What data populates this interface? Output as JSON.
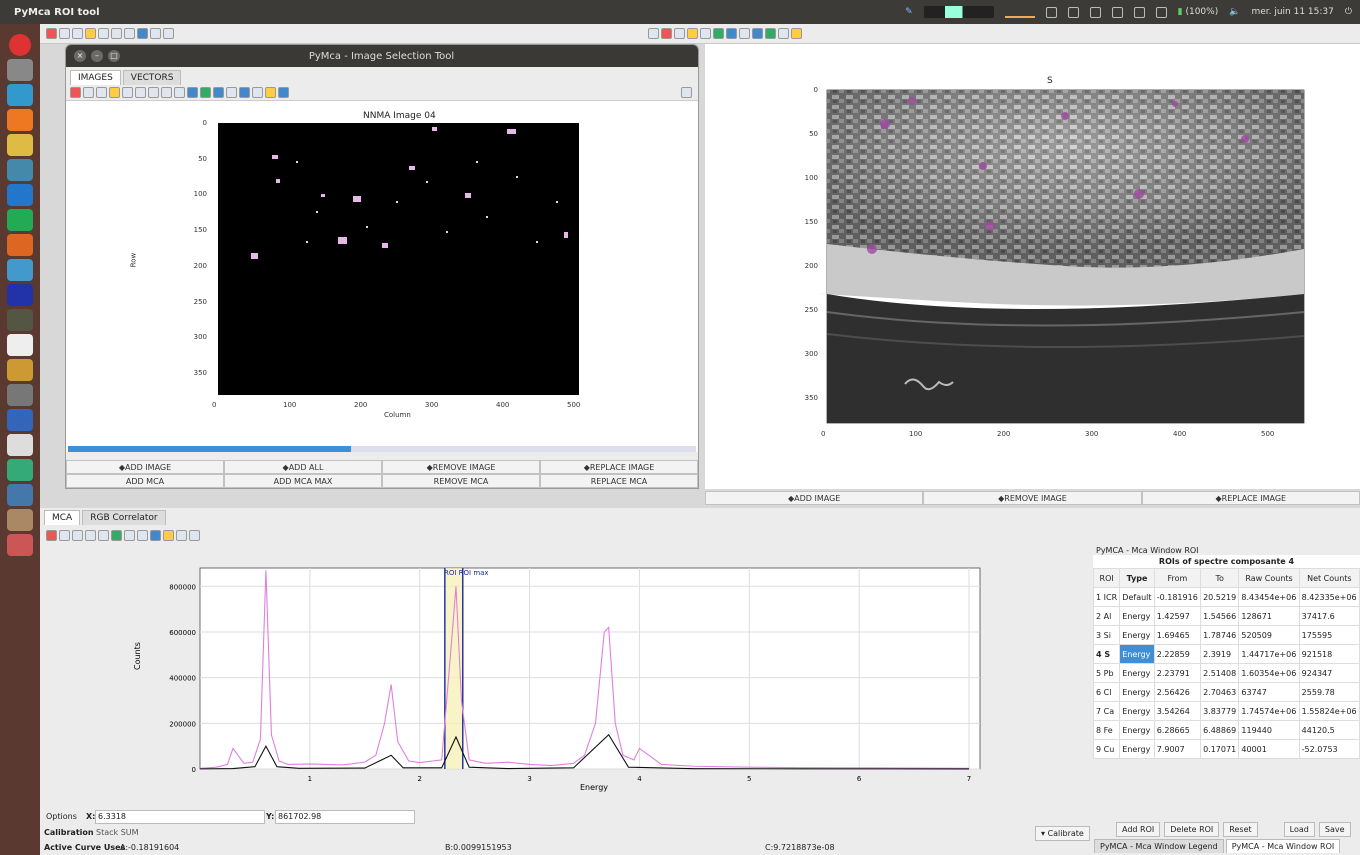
{
  "app": {
    "title": "PyMca ROI tool"
  },
  "systray": {
    "battery": "(100%)",
    "clock": "mer. juin 11  15:37"
  },
  "dialog": {
    "title": "PyMca - Image Selection Tool",
    "tabs": [
      "IMAGES",
      "VECTORS"
    ]
  },
  "left_image": {
    "title": "NNMA Image 04",
    "xlabel": "Column",
    "ylabel": "Row",
    "xticks": [
      "0",
      "100",
      "200",
      "300",
      "400",
      "500"
    ],
    "yticks": [
      "0",
      "50",
      "100",
      "150",
      "200",
      "250",
      "300",
      "350"
    ]
  },
  "right_image": {
    "title": "S",
    "xticks": [
      "0",
      "100",
      "200",
      "300",
      "400",
      "500"
    ],
    "yticks": [
      "0",
      "50",
      "100",
      "150",
      "200",
      "250",
      "300",
      "350"
    ]
  },
  "dialog_buttons_row1": [
    "ADD IMAGE",
    "ADD ALL",
    "REMOVE IMAGE",
    "REPLACE IMAGE"
  ],
  "dialog_buttons_row2": [
    "ADD MCA",
    "ADD MCA MAX",
    "REMOVE MCA",
    "REPLACE MCA"
  ],
  "right_buttons": [
    "ADD IMAGE",
    "REMOVE IMAGE",
    "REPLACE IMAGE"
  ],
  "bottom_tabs": [
    "MCA",
    "RGB Correlator"
  ],
  "mca_plot": {
    "ylabel": "Counts",
    "xlabel": "Energy",
    "yticks": [
      "0",
      "200000",
      "400000",
      "600000",
      "800000"
    ],
    "xticks": [
      "1",
      "2",
      "3",
      "4",
      "5",
      "6",
      "7"
    ],
    "markers": "ROI  ROI max"
  },
  "chart_data": {
    "type": "line",
    "title": "",
    "xlabel": "Energy",
    "ylabel": "Counts",
    "xlim": [
      0,
      7.1
    ],
    "ylim": [
      0,
      880000
    ],
    "series": [
      {
        "x": [
          0,
          0.15,
          0.25,
          0.3,
          0.4,
          0.48,
          0.55,
          0.6,
          0.65,
          0.72,
          0.8,
          1.0,
          1.3,
          1.5,
          1.6,
          1.68,
          1.74,
          1.8,
          1.9,
          2.0,
          2.2,
          2.28,
          2.33,
          2.38,
          2.45,
          2.6,
          2.8,
          3.0,
          3.2,
          3.4,
          3.5,
          3.6,
          3.68,
          3.72,
          3.78,
          3.85,
          3.95,
          4.0,
          4.2,
          4.5,
          5.0,
          5.5,
          6.0,
          6.5,
          7.0
        ],
        "y": [
          3000,
          8000,
          20000,
          90000,
          25000,
          30000,
          130000,
          870000,
          150000,
          35000,
          20000,
          22000,
          18000,
          30000,
          60000,
          200000,
          370000,
          120000,
          35000,
          28000,
          40000,
          500000,
          800000,
          300000,
          40000,
          25000,
          30000,
          20000,
          15000,
          25000,
          60000,
          200000,
          600000,
          620000,
          200000,
          60000,
          40000,
          90000,
          20000,
          12000,
          8000,
          6000,
          5000,
          4000,
          3000
        ]
      },
      {
        "x": [
          0,
          0.3,
          0.5,
          0.6,
          0.7,
          0.9,
          1.5,
          1.74,
          1.85,
          2.2,
          2.33,
          2.45,
          2.8,
          3.4,
          3.72,
          3.9,
          4.5,
          5.5,
          7.0
        ],
        "y": [
          500,
          2000,
          10000,
          100000,
          10000,
          3000,
          4000,
          60000,
          5000,
          5000,
          140000,
          8000,
          2000,
          5000,
          150000,
          8000,
          1500,
          800,
          300
        ]
      }
    ]
  },
  "cursor": {
    "options": "Options",
    "x_label": "X:",
    "x_value": "6.3318",
    "y_label": "Y:",
    "y_value": "861702.98"
  },
  "calibration": {
    "label": "Calibration",
    "value": "Stack SUM",
    "button": "Calibrate"
  },
  "active_curve": {
    "label": "Active Curve Uses",
    "a": "A:-0.18191604",
    "b": "B:0.0099151953",
    "c": "C:9.7218873e-08"
  },
  "roi_panel": {
    "window_title": "PyMCA - Mca Window ROI",
    "table_title": "ROIs of spectre composante 4",
    "headers": [
      "ROI",
      "Type",
      "From",
      "To",
      "Raw Counts",
      "Net Counts"
    ],
    "rows": [
      [
        "1 ICR",
        "Default",
        "-0.181916",
        "20.5219",
        "8.43454e+06",
        "8.42335e+06"
      ],
      [
        "2 Al",
        "Energy",
        "1.42597",
        "1.54566",
        "128671",
        "37417.6"
      ],
      [
        "3 Si",
        "Energy",
        "1.69465",
        "1.78746",
        "520509",
        "175595"
      ],
      [
        "4 S",
        "Energy",
        "2.22859",
        "2.3919",
        "1.44717e+06",
        "921518"
      ],
      [
        "5 Pb",
        "Energy",
        "2.23791",
        "2.51408",
        "1.60354e+06",
        "924347"
      ],
      [
        "6 Cl",
        "Energy",
        "2.56426",
        "2.70463",
        "63747",
        "2559.78"
      ],
      [
        "7 Ca",
        "Energy",
        "3.54264",
        "3.83779",
        "1.74574e+06",
        "1.55824e+06"
      ],
      [
        "8 Fe",
        "Energy",
        "6.28665",
        "6.48869",
        "119440",
        "44120.5"
      ],
      [
        "9 Cu",
        "Energy",
        "7.9007",
        "0.17071",
        "40001",
        "-52.0753"
      ]
    ],
    "buttons": [
      "Add ROI",
      "Delete ROI",
      "Reset",
      "Load",
      "Save"
    ],
    "bottom_tabs": [
      "PyMCA - Mca Window Legend",
      "PyMCA - Mca Window ROI"
    ]
  },
  "colors": {
    "roi_highlight": "#3d8fd8",
    "spectrum_pink": "#e07fe0",
    "spectrum_black": "#111111",
    "roi_line": "#1a2a9a"
  }
}
